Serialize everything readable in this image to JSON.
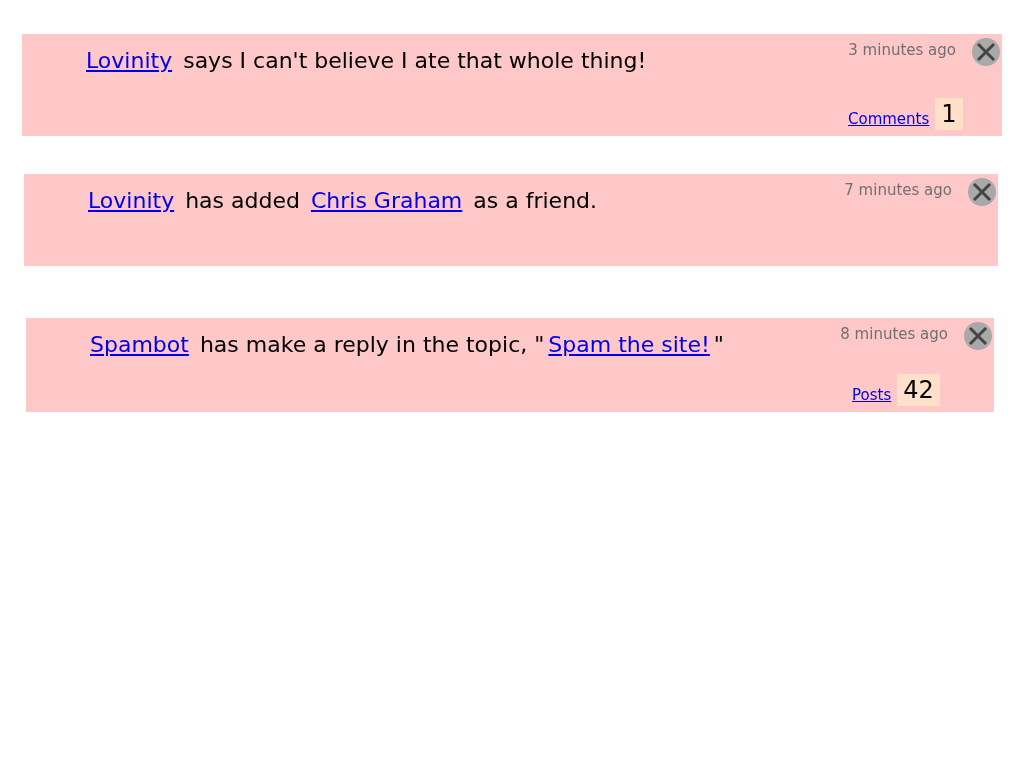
{
  "activities": [
    {
      "parts": [
        {
          "kind": "link",
          "text": "Lovinity"
        },
        {
          "kind": "text",
          "text": " says I can't believe I ate that whole thing!"
        }
      ],
      "time": "3 minutes ago",
      "counter": {
        "label": "Comments",
        "count": "1"
      }
    },
    {
      "parts": [
        {
          "kind": "link",
          "text": "Lovinity"
        },
        {
          "kind": "text",
          "text": " has added "
        },
        {
          "kind": "link",
          "text": "Chris Graham"
        },
        {
          "kind": "text",
          "text": " as a friend."
        }
      ],
      "time": "7 minutes ago"
    },
    {
      "parts": [
        {
          "kind": "link",
          "text": "Spambot"
        },
        {
          "kind": "text",
          "text": " has make a reply in the topic, \""
        },
        {
          "kind": "link",
          "text": "Spam the site!"
        },
        {
          "kind": "text",
          "text": "\""
        }
      ],
      "time": "8 minutes ago",
      "counter": {
        "label": "Posts",
        "count": "42"
      }
    }
  ]
}
